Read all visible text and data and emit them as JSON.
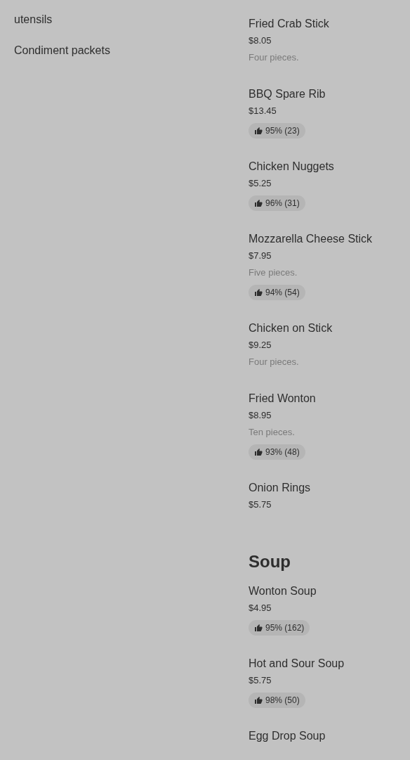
{
  "side_list": [
    "utensils",
    "Condiment packets"
  ],
  "sections": [
    {
      "items": [
        {
          "name": "Fried Crab Stick",
          "price": "$8.05",
          "description": "Four pieces."
        },
        {
          "name": "BBQ Spare Rib",
          "price": "$13.45",
          "rating": "95% (23)"
        },
        {
          "name": "Chicken Nuggets",
          "price": "$5.25",
          "rating": "96% (31)"
        },
        {
          "name": "Mozzarella Cheese Stick",
          "price": "$7.95",
          "description": "Five pieces.",
          "rating": "94% (54)"
        },
        {
          "name": "Chicken on Stick",
          "price": "$9.25",
          "description": "Four pieces."
        },
        {
          "name": "Fried Wonton",
          "price": "$8.95",
          "description": "Ten pieces.",
          "rating": "93% (48)"
        },
        {
          "name": "Onion Rings",
          "price": "$5.75"
        }
      ]
    },
    {
      "title": "Soup",
      "items": [
        {
          "name": "Wonton Soup",
          "price": "$4.95",
          "rating": "95% (162)"
        },
        {
          "name": "Hot and Sour Soup",
          "price": "$5.75",
          "rating": "98% (50)"
        },
        {
          "name": "Egg Drop Soup"
        }
      ]
    }
  ]
}
